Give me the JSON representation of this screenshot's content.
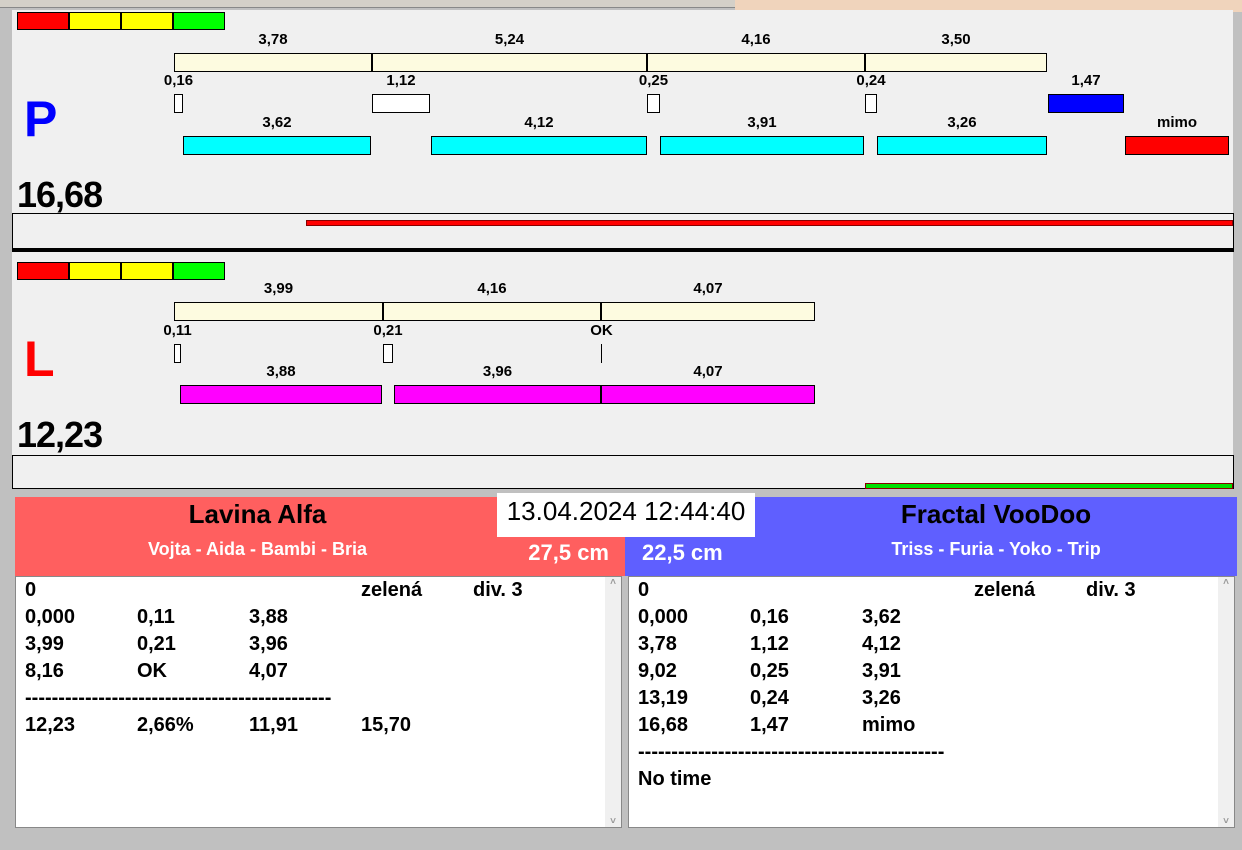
{
  "colors": {
    "cream": "#fdfbe0",
    "cyan": "#00ffff",
    "magenta": "#ff00ff",
    "blue": "#0000ff",
    "red": "#ff0000",
    "green": "#00e000",
    "leftTeam": "#ff5f5f",
    "rightTeam": "#5f5fff"
  },
  "p_panel": {
    "letter": "P",
    "total": "16,68",
    "top_labels": [
      "3,78",
      "5,24",
      "4,16",
      "3,50"
    ],
    "gap_labels": [
      "0,16",
      "1,12",
      "0,25",
      "0,24",
      "1,47"
    ],
    "bottom_labels": [
      "3,62",
      "4,12",
      "3,91",
      "3,26",
      "mimo"
    ]
  },
  "l_panel": {
    "letter": "L",
    "total": "12,23",
    "top_labels": [
      "3,99",
      "4,16",
      "4,07"
    ],
    "gap_labels": [
      "0,11",
      "0,21",
      "OK"
    ],
    "bottom_labels": [
      "3,88",
      "3,96",
      "4,07"
    ]
  },
  "datetime": "13.04.2024 12:44:40",
  "left_team": {
    "name": "Lavina Alfa",
    "dogs": "Vojta - Aida - Bambi - Bria",
    "height": "27,5 cm",
    "rows": [
      [
        "0",
        "",
        "",
        "zelená",
        "div. 3"
      ],
      [
        "0,000",
        "0,11",
        "3,88",
        "",
        ""
      ],
      [
        "3,99",
        "0,21",
        "3,96",
        "",
        ""
      ],
      [
        "8,16",
        "OK",
        "4,07",
        "",
        ""
      ],
      [
        "----------------------------------------------",
        "",
        "",
        "",
        ""
      ],
      [
        "12,23",
        "2,66%",
        "11,91",
        "15,70",
        ""
      ]
    ]
  },
  "right_team": {
    "name": "Fractal VooDoo",
    "dogs": "Triss - Furia - Yoko - Trip",
    "height": "22,5 cm",
    "rows": [
      [
        "0",
        "",
        "",
        "zelená",
        "div. 3"
      ],
      [
        "0,000",
        "0,16",
        "3,62",
        "",
        ""
      ],
      [
        "3,78",
        "1,12",
        "4,12",
        "",
        ""
      ],
      [
        "9,02",
        "0,25",
        "3,91",
        "",
        ""
      ],
      [
        "13,19",
        "0,24",
        "3,26",
        "",
        ""
      ],
      [
        "16,68",
        "1,47",
        "mimo",
        "",
        ""
      ],
      [
        "----------------------------------------------",
        "",
        "",
        "",
        ""
      ],
      [
        "No time",
        "",
        "",
        "",
        ""
      ]
    ]
  }
}
